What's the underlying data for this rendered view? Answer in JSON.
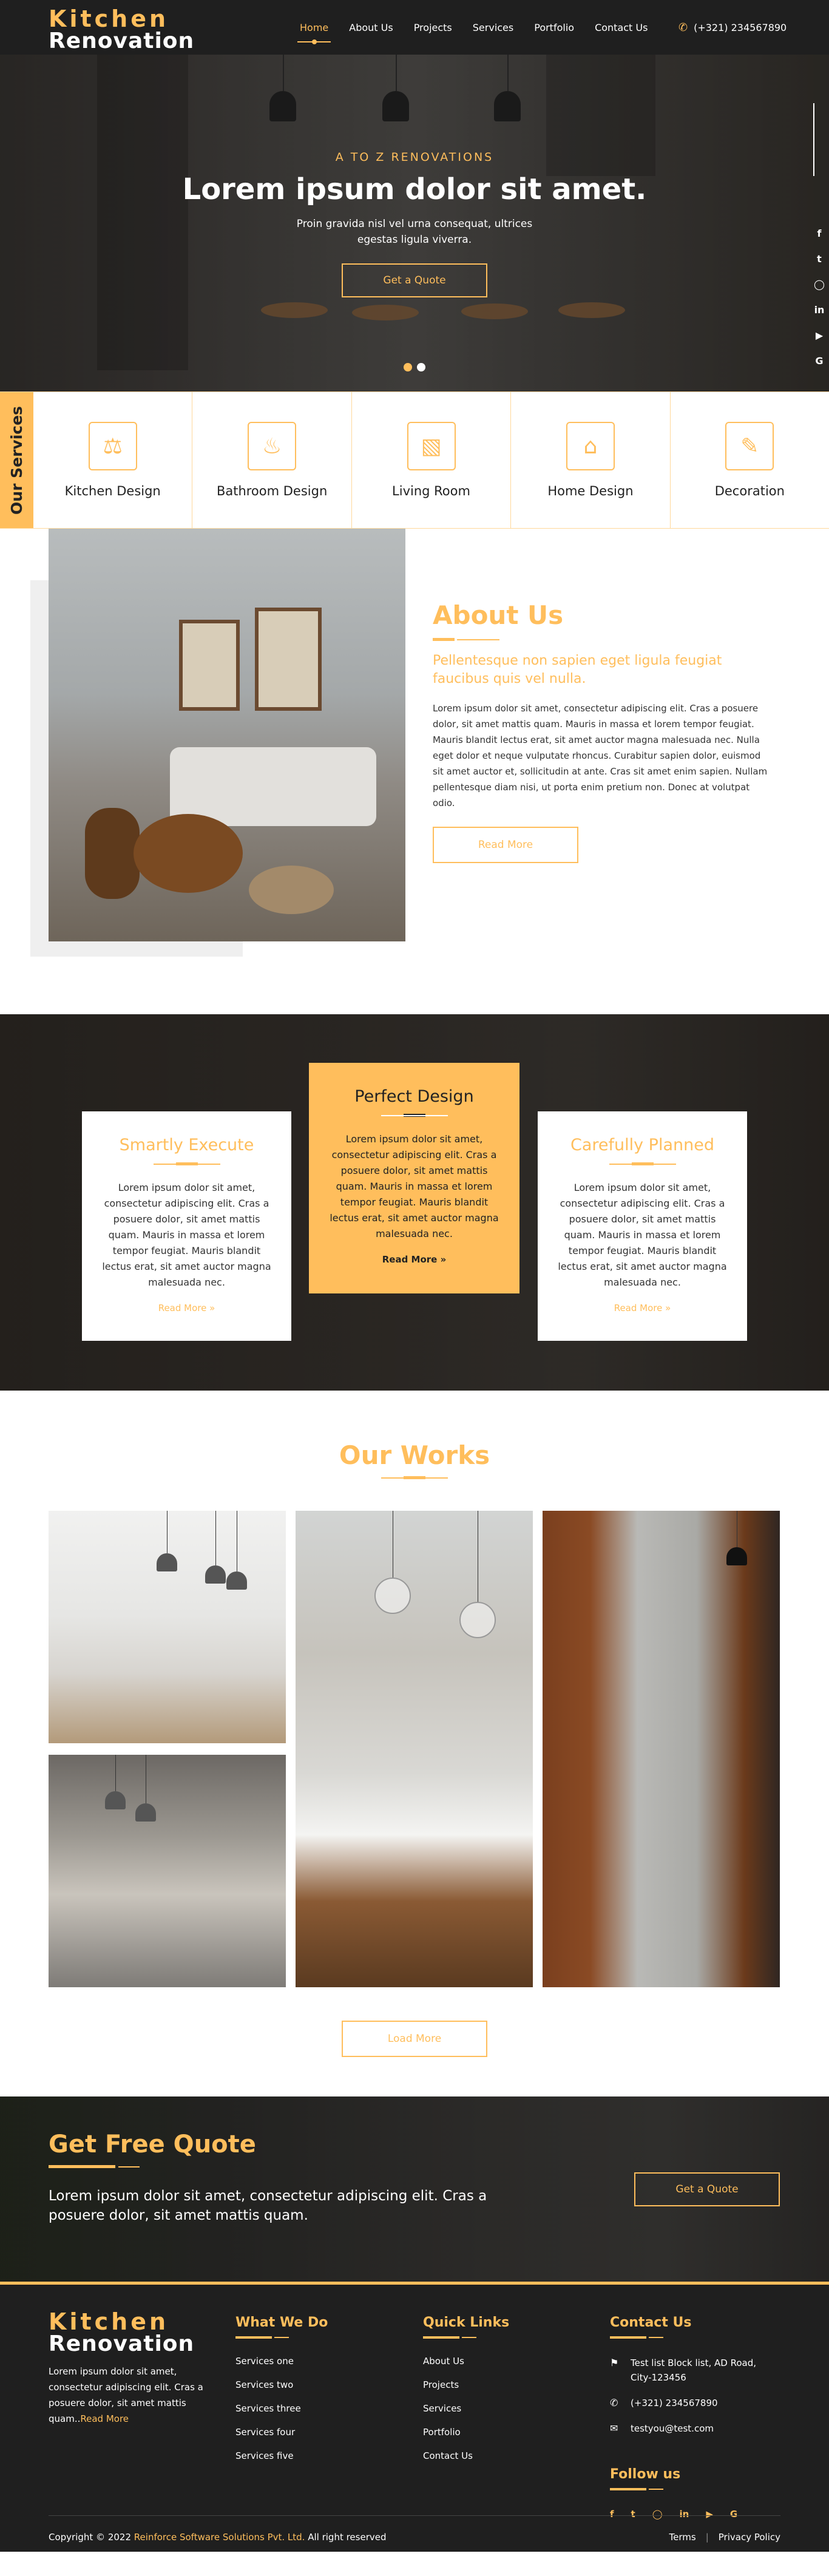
{
  "header": {
    "logo_line1": "Kitchen",
    "logo_line2": "Renovation",
    "nav": [
      "Home",
      "About Us",
      "Projects",
      "Services",
      "Portfolio",
      "Contact Us"
    ],
    "active_nav": "Home",
    "phone": "(+321) 234567890"
  },
  "hero": {
    "subtitle": "A TO Z RENOVATIONS",
    "title": "Lorem ipsum dolor sit amet.",
    "description": "Proin gravida nisl vel urna consequat, ultrices egestas ligula viverra.",
    "button": "Get a Quote",
    "slide_active": 1,
    "slide_count": 2,
    "social": [
      "facebook-icon",
      "twitter-icon",
      "instagram-icon",
      "linkedin-icon",
      "youtube-icon",
      "google-icon"
    ]
  },
  "services": {
    "tab_label": "Our Services",
    "items": [
      {
        "label": "Kitchen Design",
        "icon": "kitchen-icon"
      },
      {
        "label": "Bathroom Design",
        "icon": "bathroom-icon"
      },
      {
        "label": "Living Room",
        "icon": "living-room-icon"
      },
      {
        "label": "Home Design",
        "icon": "home-icon"
      },
      {
        "label": "Decoration",
        "icon": "decoration-icon"
      }
    ]
  },
  "about": {
    "title": "About Us",
    "lead": "Pellentesque non sapien eget ligula feugiat faucibus quis vel nulla.",
    "body": "Lorem ipsum dolor sit amet, consectetur adipiscing elit. Cras a posuere dolor, sit amet mattis quam. Mauris in massa et lorem tempor feugiat. Mauris blandit lectus erat, sit amet auctor magna malesuada nec. Nulla eget dolor et neque vulputate rhoncus. Curabitur sapien dolor, euismod sit amet auctor et, sollicitudin at ante. Cras sit amet enim sapien. Nullam pellentesque diam nisi, ut porta enim pretium non. Donec at volutpat odio.",
    "button": "Read More"
  },
  "features": [
    {
      "title": "Smartly Execute",
      "desc": "Lorem ipsum dolor sit amet, consectetur adipiscing elit. Cras a posuere dolor, sit amet mattis quam. Mauris in massa et lorem tempor feugiat. Mauris blandit lectus erat, sit amet auctor magna malesuada nec.",
      "more": "Read More »"
    },
    {
      "title": "Perfect Design",
      "desc": "Lorem ipsum dolor sit amet, consectetur adipiscing elit. Cras a posuere dolor, sit amet mattis quam. Mauris in massa et lorem tempor feugiat. Mauris blandit lectus erat, sit amet auctor magna malesuada nec.",
      "more": "Read More »"
    },
    {
      "title": "Carefully Planned",
      "desc": "Lorem ipsum dolor sit amet, consectetur adipiscing elit. Cras a posuere dolor, sit amet mattis quam. Mauris in massa et lorem tempor feugiat. Mauris blandit lectus erat, sit amet auctor magna malesuada nec.",
      "more": "Read More »"
    }
  ],
  "works": {
    "title": "Our Works",
    "button": "Load More"
  },
  "quote": {
    "title": "Get Free Quote",
    "text": "Lorem ipsum dolor sit amet, consectetur adipiscing elit. Cras a posuere dolor, sit amet mattis quam.",
    "button": "Get a Quote"
  },
  "footer": {
    "logo_line1": "Kitchen",
    "logo_line2": "Renovation",
    "about": "Lorem ipsum dolor sit amet, consectetur adipiscing elit. Cras a posuere dolor, sit amet mattis quam..",
    "read_more": "Read More",
    "what_we_do": {
      "title": "What We Do",
      "items": [
        "Services one",
        "Services two",
        "Services three",
        "Services four",
        "Services five"
      ]
    },
    "quick_links": {
      "title": "Quick Links",
      "items": [
        "About Us",
        "Projects",
        "Services",
        "Portfolio",
        "Contact Us"
      ]
    },
    "contact": {
      "title": "Contact Us",
      "address": "Test list Block list, AD Road, City-123456",
      "phone": "(+321) 234567890",
      "email": "testyou@test.com"
    },
    "follow": {
      "title": "Follow us",
      "icons": [
        "facebook-icon",
        "twitter-icon",
        "instagram-icon",
        "linkedin-icon",
        "youtube-icon",
        "google-icon"
      ]
    },
    "copyright_prefix": "Copyright © 2022",
    "company": "Reinforce Software Solutions Pvt. Ltd.",
    "rights": "All right reserved",
    "terms": "Terms",
    "privacy": "Privacy Policy"
  },
  "colors": {
    "accent": "#ffbe5c",
    "dark": "#1f1f1f"
  }
}
